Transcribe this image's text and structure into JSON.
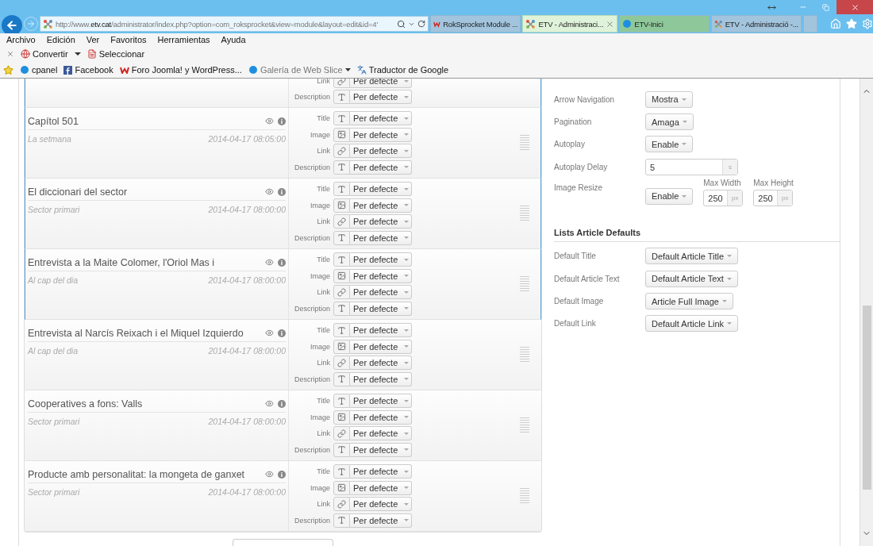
{
  "browser": {
    "address": {
      "host_prefix": "http://www.",
      "host": "etv.cat",
      "path": "/administrator/index.php?option=com_roksprocket&view=module&layout=edit&id=4'"
    },
    "tabs": [
      {
        "label": "RokSprocket Module ...",
        "selected": false,
        "color": "#a3c4dd"
      },
      {
        "label": "ETV - Administraci...",
        "selected": true,
        "color": "#def3da"
      },
      {
        "label": "ETV-Inici",
        "selected": false,
        "color": "#8ec89a"
      },
      {
        "label": "ETV - Administració -...",
        "selected": false,
        "color": "#a3c4dd"
      }
    ],
    "menu": [
      "Archivo",
      "Edición",
      "Ver",
      "Favoritos",
      "Herramientas",
      "Ayuda"
    ],
    "commands": [
      {
        "label": "Convertir",
        "dropdown": true
      },
      {
        "label": "Seleccionar",
        "dropdown": false
      }
    ],
    "favorites": [
      {
        "label": "cpanel",
        "dropdown": false,
        "disabled": false
      },
      {
        "label": "Facebook",
        "dropdown": false,
        "disabled": false
      },
      {
        "label": "Foro Joomla! y WordPress...",
        "dropdown": false,
        "disabled": false
      },
      {
        "label": "Galería de Web Slice",
        "dropdown": true,
        "disabled": true
      },
      {
        "label": "Traductor de Google",
        "dropdown": false,
        "disabled": false
      }
    ]
  },
  "items": [
    {
      "selected": true,
      "fields": [
        {
          "label": "Link",
          "kind": "link",
          "value": "Per defecte"
        },
        {
          "label": "Description",
          "kind": "text",
          "value": "Per defecte"
        }
      ]
    },
    {
      "title": "Capítol 501",
      "category": "La setmana",
      "date": "2014-04-17 08:05:00",
      "selected": true,
      "fields": [
        {
          "label": "Title",
          "kind": "text",
          "value": "Per defecte"
        },
        {
          "label": "Image",
          "kind": "image",
          "value": "Per defecte"
        },
        {
          "label": "Link",
          "kind": "link",
          "value": "Per defecte"
        },
        {
          "label": "Description",
          "kind": "text",
          "value": "Per defecte"
        }
      ]
    },
    {
      "title": "El diccionari del sector",
      "category": "Sector primari",
      "date": "2014-04-17 08:00:00",
      "selected": true,
      "fields": [
        {
          "label": "Title",
          "kind": "text",
          "value": "Per defecte"
        },
        {
          "label": "Image",
          "kind": "image",
          "value": "Per defecte"
        },
        {
          "label": "Link",
          "kind": "link",
          "value": "Per defecte"
        },
        {
          "label": "Description",
          "kind": "text",
          "value": "Per defecte"
        }
      ]
    },
    {
      "title": "Entrevista a la Maite Colomer, l'Oriol Mas i",
      "category": "Al cap del dia",
      "date": "2014-04-17 08:00:00",
      "selected": true,
      "fields": [
        {
          "label": "Title",
          "kind": "text",
          "value": "Per defecte"
        },
        {
          "label": "Image",
          "kind": "image",
          "value": "Per defecte"
        },
        {
          "label": "Link",
          "kind": "link",
          "value": "Per defecte"
        },
        {
          "label": "Description",
          "kind": "text",
          "value": "Per defecte"
        }
      ]
    },
    {
      "title": "Entrevista al Narcís Reixach i el Miquel Izquierdo",
      "category": "Al cap del dia",
      "date": "2014-04-17 08:00:00",
      "selected": false,
      "fields": [
        {
          "label": "Title",
          "kind": "text",
          "value": "Per defecte"
        },
        {
          "label": "Image",
          "kind": "image",
          "value": "Per defecte"
        },
        {
          "label": "Link",
          "kind": "link",
          "value": "Per defecte"
        },
        {
          "label": "Description",
          "kind": "text",
          "value": "Per defecte"
        }
      ]
    },
    {
      "title": "Cooperatives a fons: Valls",
      "category": "Sector primari",
      "date": "2014-04-17 08:00:00",
      "selected": false,
      "fields": [
        {
          "label": "Title",
          "kind": "text",
          "value": "Per defecte"
        },
        {
          "label": "Image",
          "kind": "image",
          "value": "Per defecte"
        },
        {
          "label": "Link",
          "kind": "link",
          "value": "Per defecte"
        },
        {
          "label": "Description",
          "kind": "text",
          "value": "Per defecte"
        }
      ]
    },
    {
      "title": "Producte amb personalitat: la mongeta de ganxet",
      "category": "Sector primari",
      "date": "2014-04-17 08:00:00",
      "selected": false,
      "fields": [
        {
          "label": "Title",
          "kind": "text",
          "value": "Per defecte"
        },
        {
          "label": "Image",
          "kind": "image",
          "value": "Per defecte"
        },
        {
          "label": "Link",
          "kind": "link",
          "value": "Per defecte"
        },
        {
          "label": "Description",
          "kind": "text",
          "value": "Per defecte"
        }
      ]
    }
  ],
  "settings": [
    {
      "label": "Arrow Navigation",
      "kind": "select",
      "value": "Mostra"
    },
    {
      "label": "Pagination",
      "kind": "select",
      "value": "Amaga"
    },
    {
      "label": "Autoplay",
      "kind": "select",
      "value": "Enable"
    },
    {
      "label": "Autoplay Delay",
      "kind": "input",
      "value": "5",
      "unit": "s"
    },
    {
      "label": "Image Resize",
      "kind": "resize",
      "value": "Enable",
      "width": {
        "label": "Max Width",
        "value": "250",
        "unit": "px"
      },
      "height": {
        "label": "Max Height",
        "value": "250",
        "unit": "px"
      }
    }
  ],
  "defaults": {
    "heading": "Lists Article Defaults",
    "rows": [
      {
        "label": "Default Title",
        "kind": "select",
        "value": "Default Article Title"
      },
      {
        "label": "Default Article Text",
        "kind": "select",
        "value": "Default Article Text"
      },
      {
        "label": "Default Image",
        "kind": "select",
        "value": "Article Full Image"
      },
      {
        "label": "Default Link",
        "kind": "select",
        "value": "Default Article Link"
      }
    ]
  }
}
